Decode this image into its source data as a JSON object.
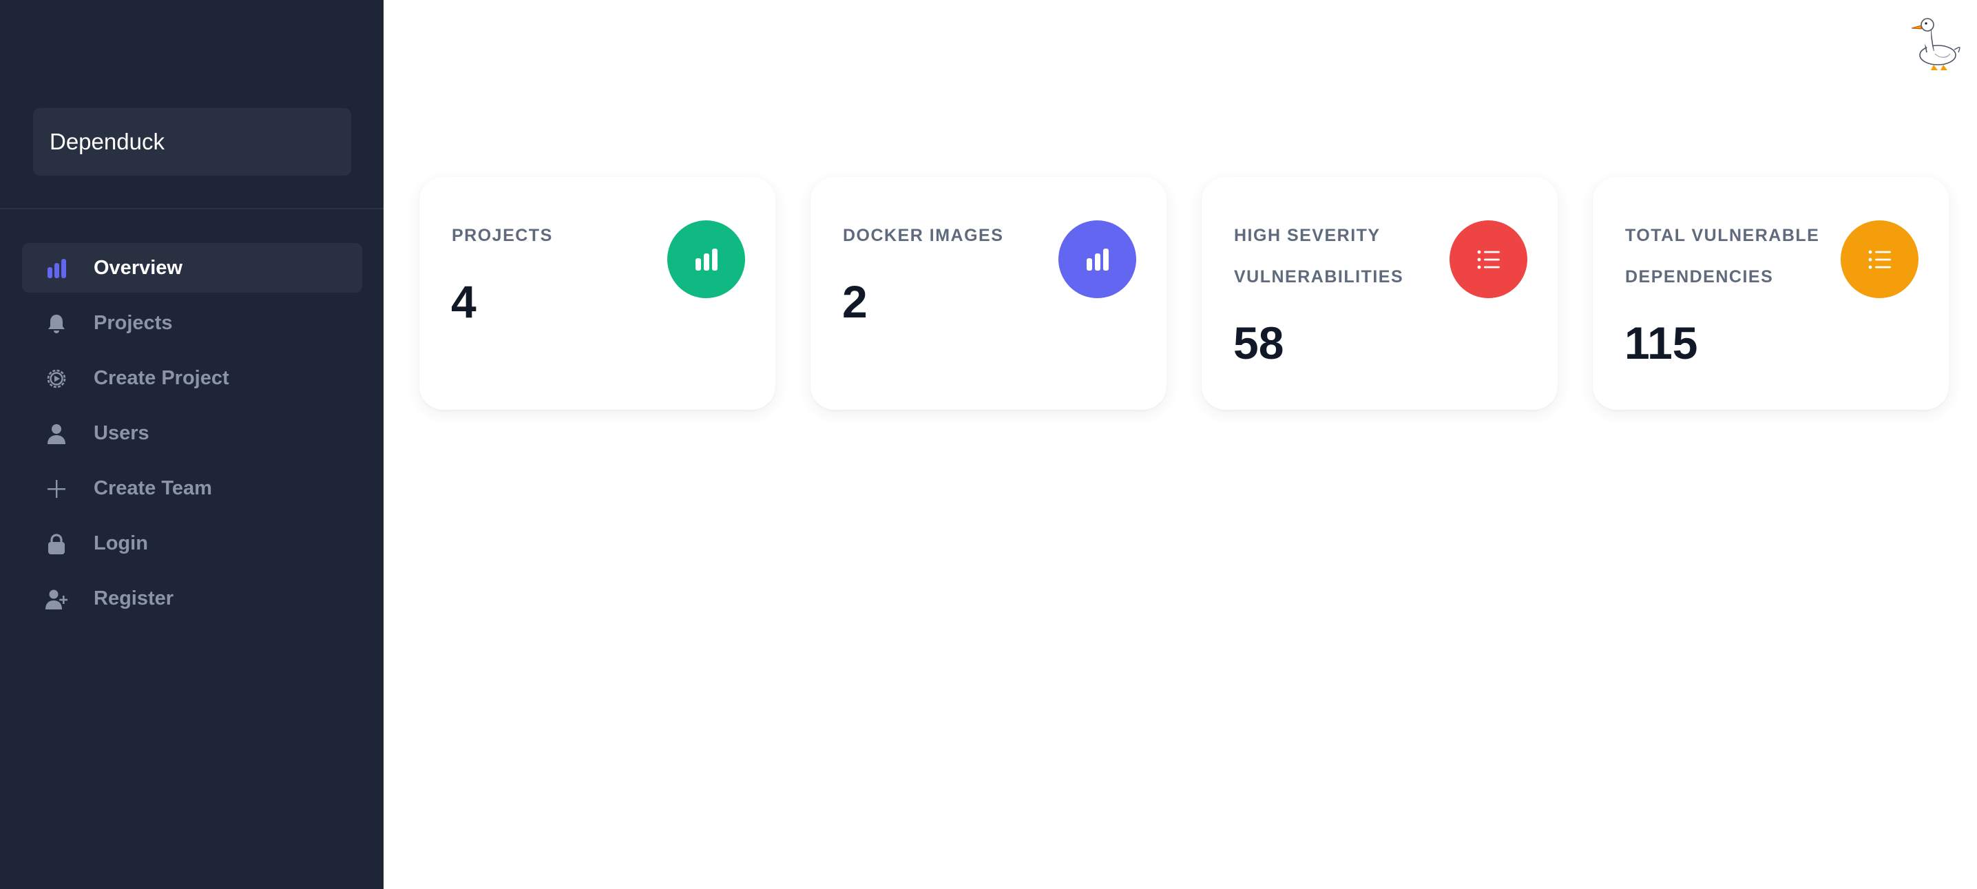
{
  "app": {
    "brand": "Dependuck"
  },
  "sidebar": {
    "items": [
      {
        "label": "Overview",
        "icon": "bar-chart-icon",
        "active": true
      },
      {
        "label": "Projects",
        "icon": "bell-icon",
        "active": false
      },
      {
        "label": "Create Project",
        "icon": "gear-icon",
        "active": false
      },
      {
        "label": "Users",
        "icon": "user-icon",
        "active": false
      },
      {
        "label": "Create Team",
        "icon": "plus-icon",
        "active": false
      },
      {
        "label": "Login",
        "icon": "lock-icon",
        "active": false
      },
      {
        "label": "Register",
        "icon": "user-plus-icon",
        "active": false
      }
    ]
  },
  "header": {
    "logo_icon": "duck-icon"
  },
  "stats": [
    {
      "title": "PROJECTS",
      "value": "4",
      "icon": "bar-chart-icon",
      "color": "#10b981"
    },
    {
      "title": "DOCKER IMAGES",
      "value": "2",
      "icon": "bar-chart-icon",
      "color": "#6366f1"
    },
    {
      "title": "HIGH SEVERITY VULNERABILITIES",
      "value": "58",
      "icon": "list-icon",
      "color": "#ef4444"
    },
    {
      "title": "TOTAL VULNERABLE DEPENDENCIES",
      "value": "115",
      "icon": "list-icon",
      "color": "#f59e0b"
    }
  ],
  "colors": {
    "sidebar_bg": "#1e2536",
    "active_item_bg": "#283041",
    "accent": "#6366f1",
    "muted_text": "#8c95a7"
  }
}
